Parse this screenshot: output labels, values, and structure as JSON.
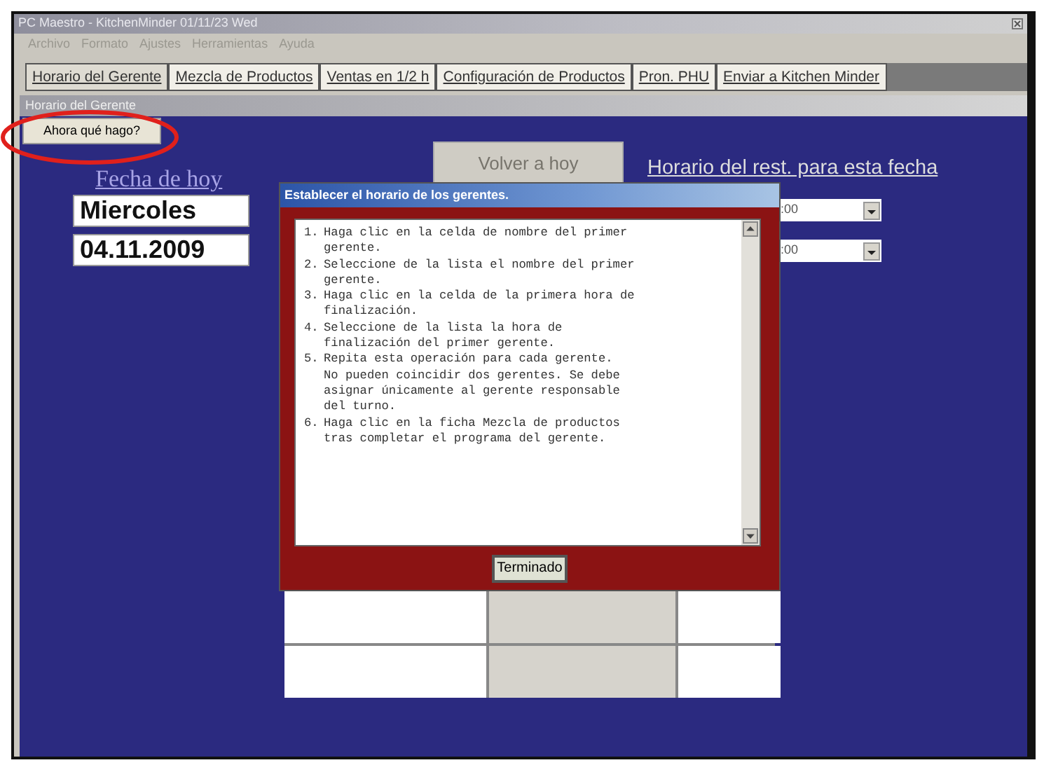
{
  "window": {
    "title": "PC Maestro - KitchenMinder 01/11/23 Wed"
  },
  "menu": [
    "Archivo",
    "Formato",
    "Ajustes",
    "Herramientas",
    "Ayuda"
  ],
  "tabs": [
    {
      "label": "Horario del Gerente",
      "selected": true
    },
    {
      "label": "Mezcla de Productos",
      "selected": false
    },
    {
      "label": "Ventas en 1/2 h",
      "selected": false
    },
    {
      "label": "Configuración de Productos",
      "selected": false
    },
    {
      "label": "Pron. PHU",
      "selected": false
    },
    {
      "label": "Enviar a Kitchen Minder",
      "selected": false
    }
  ],
  "section_title": "Horario del Gerente",
  "help_button": "Ahora qué hago?",
  "date_label": "Fecha de hoy",
  "day_field": "Miercoles",
  "date_field": "04.11.2009",
  "today_button": "Volver a hoy",
  "schedule_label": "Horario del rest. para esta fecha",
  "schedule_dropdowns": [
    ":00",
    ":00"
  ],
  "dialog": {
    "title": "Establecer el horario de los gerentes.",
    "instructions": [
      {
        "number": "1.",
        "lines": [
          "Haga clic en la celda de nombre del primer",
          "gerente."
        ]
      },
      {
        "number": "2.",
        "lines": [
          "Seleccione de la lista el nombre del primer",
          "gerente."
        ]
      },
      {
        "number": "3.",
        "lines": [
          "Haga clic en la celda de la primera hora de",
          "finalización."
        ]
      },
      {
        "number": "4.",
        "lines": [
          "Seleccione de la lista la hora de",
          "finalización del primer gerente."
        ]
      },
      {
        "number": "5.",
        "lines": [
          "Repita esta operación para cada gerente.",
          "No pueden coincidir dos gerentes.  Se debe",
          "asignar únicamente al gerente responsable",
          "del turno."
        ]
      },
      {
        "number": "6.",
        "lines": [
          "Haga clic en la ficha Mezcla de productos",
          "tras completar el programa del gerente."
        ]
      }
    ],
    "button": "Terminado"
  },
  "grid": {
    "rows": [
      {
        "cells": [
          {
            "kind": "input"
          },
          {
            "kind": "readonly"
          },
          {
            "kind": "input"
          }
        ]
      },
      {
        "cells": [
          {
            "kind": "input"
          },
          {
            "kind": "readonly"
          },
          {
            "kind": "input"
          }
        ]
      }
    ]
  },
  "highlight": {
    "kind": "circle"
  }
}
